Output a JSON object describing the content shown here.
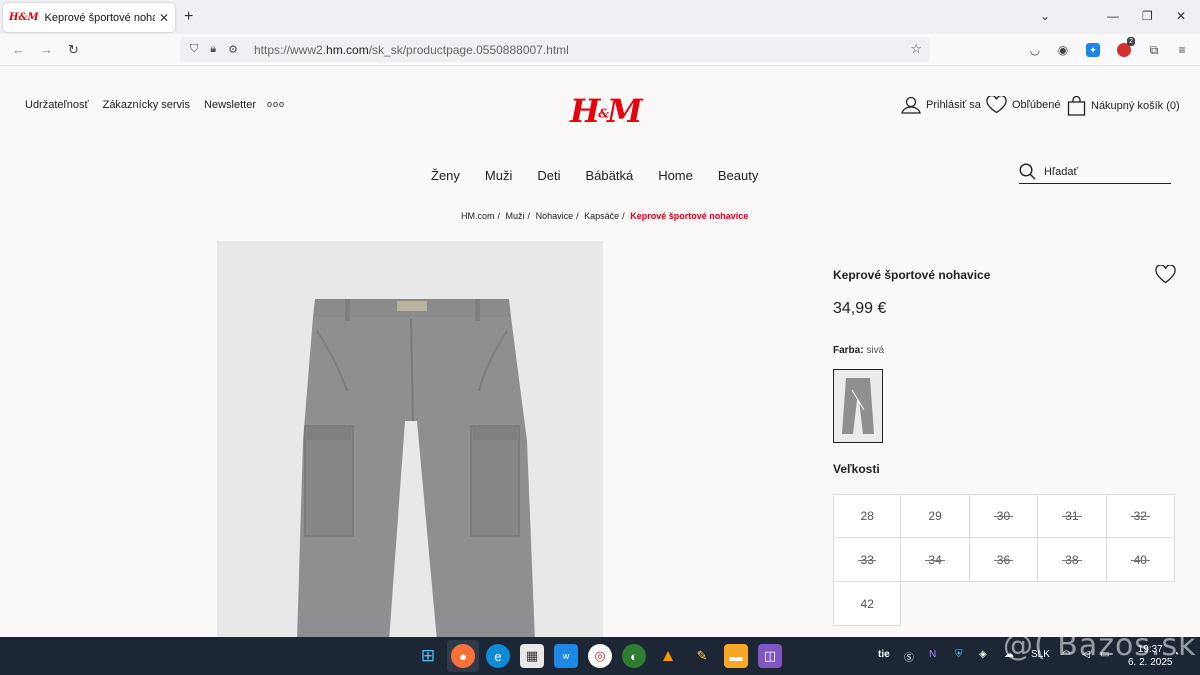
{
  "browser": {
    "tab_title": "Keprové športové nohavice - sk",
    "tab_favicon": "H&M",
    "url_prefix": "https://www2.",
    "url_domain": "hm.com",
    "url_path": "/sk_sk/productpage.0550888007.html",
    "notification_badge": "2"
  },
  "header": {
    "top_links": [
      "Udržateľnosť",
      "Zákaznícky servis",
      "Newsletter"
    ],
    "more_dots": "ooo",
    "logo": "H&M",
    "login_label": "Prihlásiť sa",
    "favorites_label": "Obľúbené",
    "cart_label": "Nákupný košík (0)"
  },
  "nav": {
    "items": [
      "Ženy",
      "Muži",
      "Deti",
      "Bábätká",
      "Home",
      "Beauty"
    ],
    "search_placeholder": "Hľadať"
  },
  "breadcrumb": {
    "items": [
      "HM.com",
      "Muži",
      "Nohavice",
      "Kapsáče"
    ],
    "current": "Keprové športové nohavice",
    "separator": "/"
  },
  "product": {
    "name": "Keprové športové nohavice",
    "price": "34,99 €",
    "color_label": "Farba:",
    "color_value": "sivá",
    "sizes_title": "Veľkosti",
    "sizes": [
      {
        "label": "28",
        "available": true
      },
      {
        "label": "29",
        "available": true
      },
      {
        "label": "30",
        "available": false
      },
      {
        "label": "31",
        "available": false
      },
      {
        "label": "32",
        "available": false
      },
      {
        "label": "33",
        "available": false
      },
      {
        "label": "34",
        "available": false
      },
      {
        "label": "36",
        "available": false
      },
      {
        "label": "38",
        "available": false
      },
      {
        "label": "40",
        "available": false
      },
      {
        "label": "42",
        "available": true
      }
    ]
  },
  "taskbar": {
    "tray_text": "tie",
    "lang": "SLK",
    "time": "19:37",
    "date": "6. 2. 2025"
  },
  "watermark": "@( Bazos.sk",
  "colors": {
    "brand_red": "#e50010",
    "taskbar_bg": "#1c2634"
  }
}
